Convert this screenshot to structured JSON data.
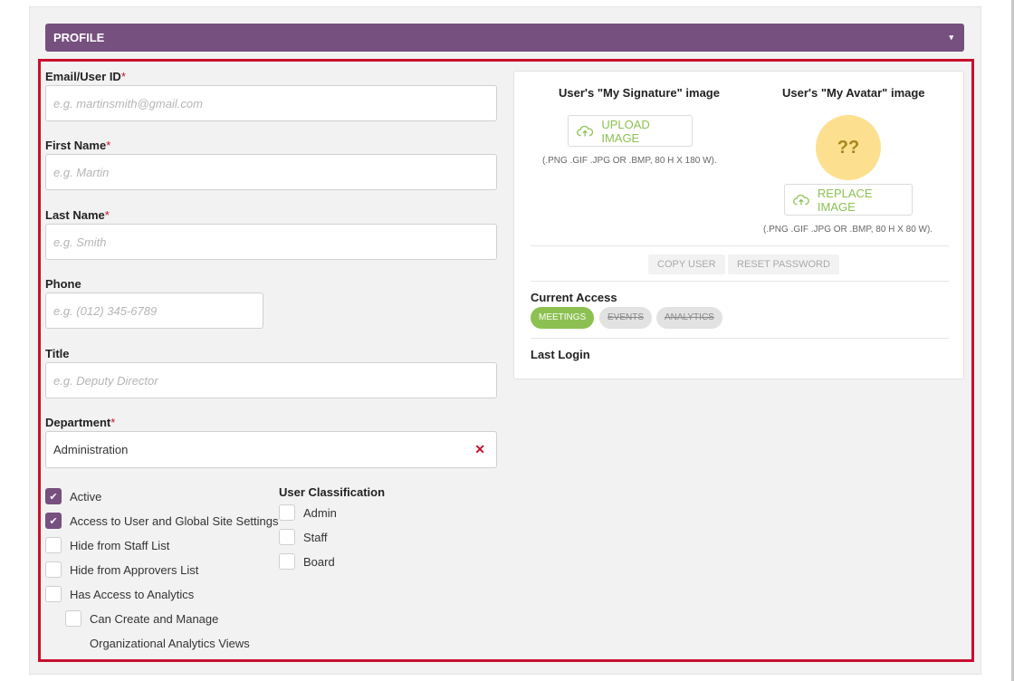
{
  "header": {
    "title": "PROFILE",
    "caret": "▾"
  },
  "form": {
    "email": {
      "label": "Email/User ID",
      "required": "*",
      "placeholder": "e.g. martinsmith@gmail.com"
    },
    "first_name": {
      "label": "First Name",
      "required": "*",
      "placeholder": "e.g. Martin"
    },
    "last_name": {
      "label": "Last Name",
      "required": "*",
      "placeholder": "e.g. Smith"
    },
    "phone": {
      "label": "Phone",
      "placeholder": "e.g. (012) 345-6789"
    },
    "title": {
      "label": "Title",
      "placeholder": "e.g. Deputy Director"
    },
    "department": {
      "label": "Department",
      "required": "*",
      "value": "Administration",
      "clear": "✕"
    }
  },
  "checkboxes": [
    {
      "label": "Active",
      "checked": true
    },
    {
      "label": "Access to User and Global Site Settings",
      "checked": true
    },
    {
      "label": "Hide from Staff List",
      "checked": false
    },
    {
      "label": "Hide from Approvers List",
      "checked": false
    },
    {
      "label": "Has Access to Analytics",
      "checked": false
    },
    {
      "label": "Can Create and Manage",
      "checked": false,
      "continuation": "Organizational Analytics Views"
    }
  ],
  "user_classification": {
    "title": "User Classification",
    "options": [
      {
        "label": "Admin",
        "checked": false
      },
      {
        "label": "Staff",
        "checked": false
      },
      {
        "label": "Board",
        "checked": false
      }
    ]
  },
  "signature": {
    "title": "User's \"My Signature\" image",
    "button": "UPLOAD IMAGE",
    "hint": "(.PNG .GIF .JPG OR .BMP, 80 H X 180 W)."
  },
  "avatar": {
    "title": "User's \"My Avatar\" image",
    "placeholder": "??",
    "button": "REPLACE IMAGE",
    "hint": "(.PNG .GIF .JPG OR .BMP, 80 H X 80 W)."
  },
  "actions": {
    "copy_user": "COPY USER",
    "reset_password": "RESET PASSWORD"
  },
  "access": {
    "title": "Current Access",
    "tags": [
      {
        "label": "MEETINGS",
        "active": true
      },
      {
        "label": "EVENTS",
        "active": false
      },
      {
        "label": "ANALYTICS",
        "active": false
      }
    ]
  },
  "last_login": {
    "title": "Last Login"
  },
  "colors": {
    "brand": "#76507e",
    "accent_green": "#8cc152",
    "required_red": "#c8102e",
    "avatar_yellow": "#fde08f"
  },
  "icons": {
    "upload": "cloud-upload-icon",
    "check": "check-icon",
    "clear": "close-icon",
    "caret": "caret-down-icon"
  }
}
